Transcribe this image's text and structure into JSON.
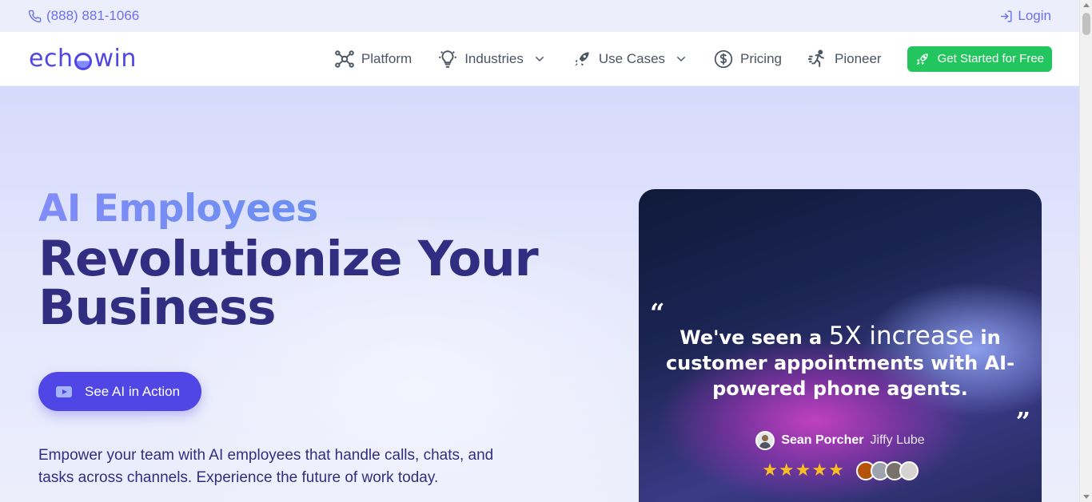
{
  "topbar": {
    "phone": "(888) 881-1066",
    "login": "Login"
  },
  "nav": {
    "logo": {
      "prefix": "ech",
      "suffix": "win"
    },
    "items": [
      {
        "label": "Platform",
        "icon": "network-icon",
        "has_dropdown": false
      },
      {
        "label": "Industries",
        "icon": "lightbulb-icon",
        "has_dropdown": true
      },
      {
        "label": "Use Cases",
        "icon": "rocket-icon",
        "has_dropdown": true
      },
      {
        "label": "Pricing",
        "icon": "dollar-circle-icon",
        "has_dropdown": false
      },
      {
        "label": "Pioneer",
        "icon": "runner-icon",
        "has_dropdown": false
      }
    ],
    "cta": "Get Started for Free"
  },
  "hero": {
    "eyebrow": "AI Employees",
    "headline_line1": "Revolutionize Your",
    "headline_line2": "Business",
    "button": "See AI in Action",
    "subtext": "Empower your team with AI employees that handle calls, chats, and tasks across channels. Experience the future of work today."
  },
  "testimonial": {
    "quote_pre": "We've seen a ",
    "quote_highlight": "5X increase",
    "quote_post": " in customer appointments with AI-powered phone agents.",
    "author_name": "Sean Porcher",
    "author_company": "Jiffy Lube",
    "stars": "★★★★★",
    "rating": 5
  },
  "colors": {
    "brand": "#4f46e5",
    "cta_green": "#22c55e",
    "headline": "#312e81",
    "star": "#fbbf24"
  }
}
